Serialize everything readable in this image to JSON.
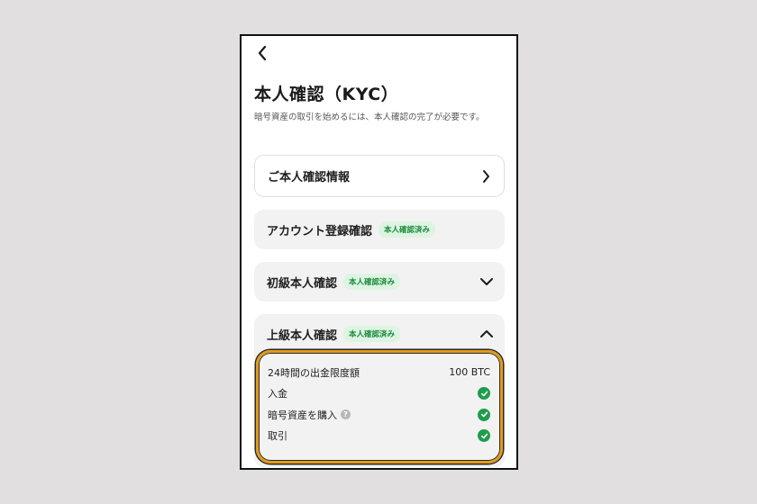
{
  "header": {
    "back_icon": "chevron-left-icon",
    "title": "本人確認（KYC）",
    "description": "暗号資産の取引を始めるには、本人確認の完了が必要です。"
  },
  "cards": {
    "info": {
      "label": "ご本人確認情報",
      "icon": "chevron-right-icon"
    },
    "account": {
      "label": "アカウント登録確認",
      "badge": "本人確認済み"
    },
    "basic": {
      "label": "初級本人確認",
      "badge": "本人確認済み",
      "icon": "chevron-down-icon"
    },
    "advanced": {
      "label": "上級本人確認",
      "badge": "本人確認済み",
      "icon": "chevron-up-icon",
      "limits": [
        {
          "label": "24時間の出金限度額",
          "value": "100 BTC"
        },
        {
          "label": "入金",
          "status": "check-circle-icon"
        },
        {
          "label": "暗号資産を購入",
          "help": "?",
          "status": "check-circle-icon"
        },
        {
          "label": "取引",
          "status": "check-circle-icon"
        }
      ]
    }
  },
  "colors": {
    "background": "#e1dfe0",
    "card_grey": "#f2f2f2",
    "badge_bg": "#ddf4e3",
    "badge_text": "#1c8b3a",
    "check_green": "#1f9d4c",
    "highlight_orange": "#e29a18"
  }
}
